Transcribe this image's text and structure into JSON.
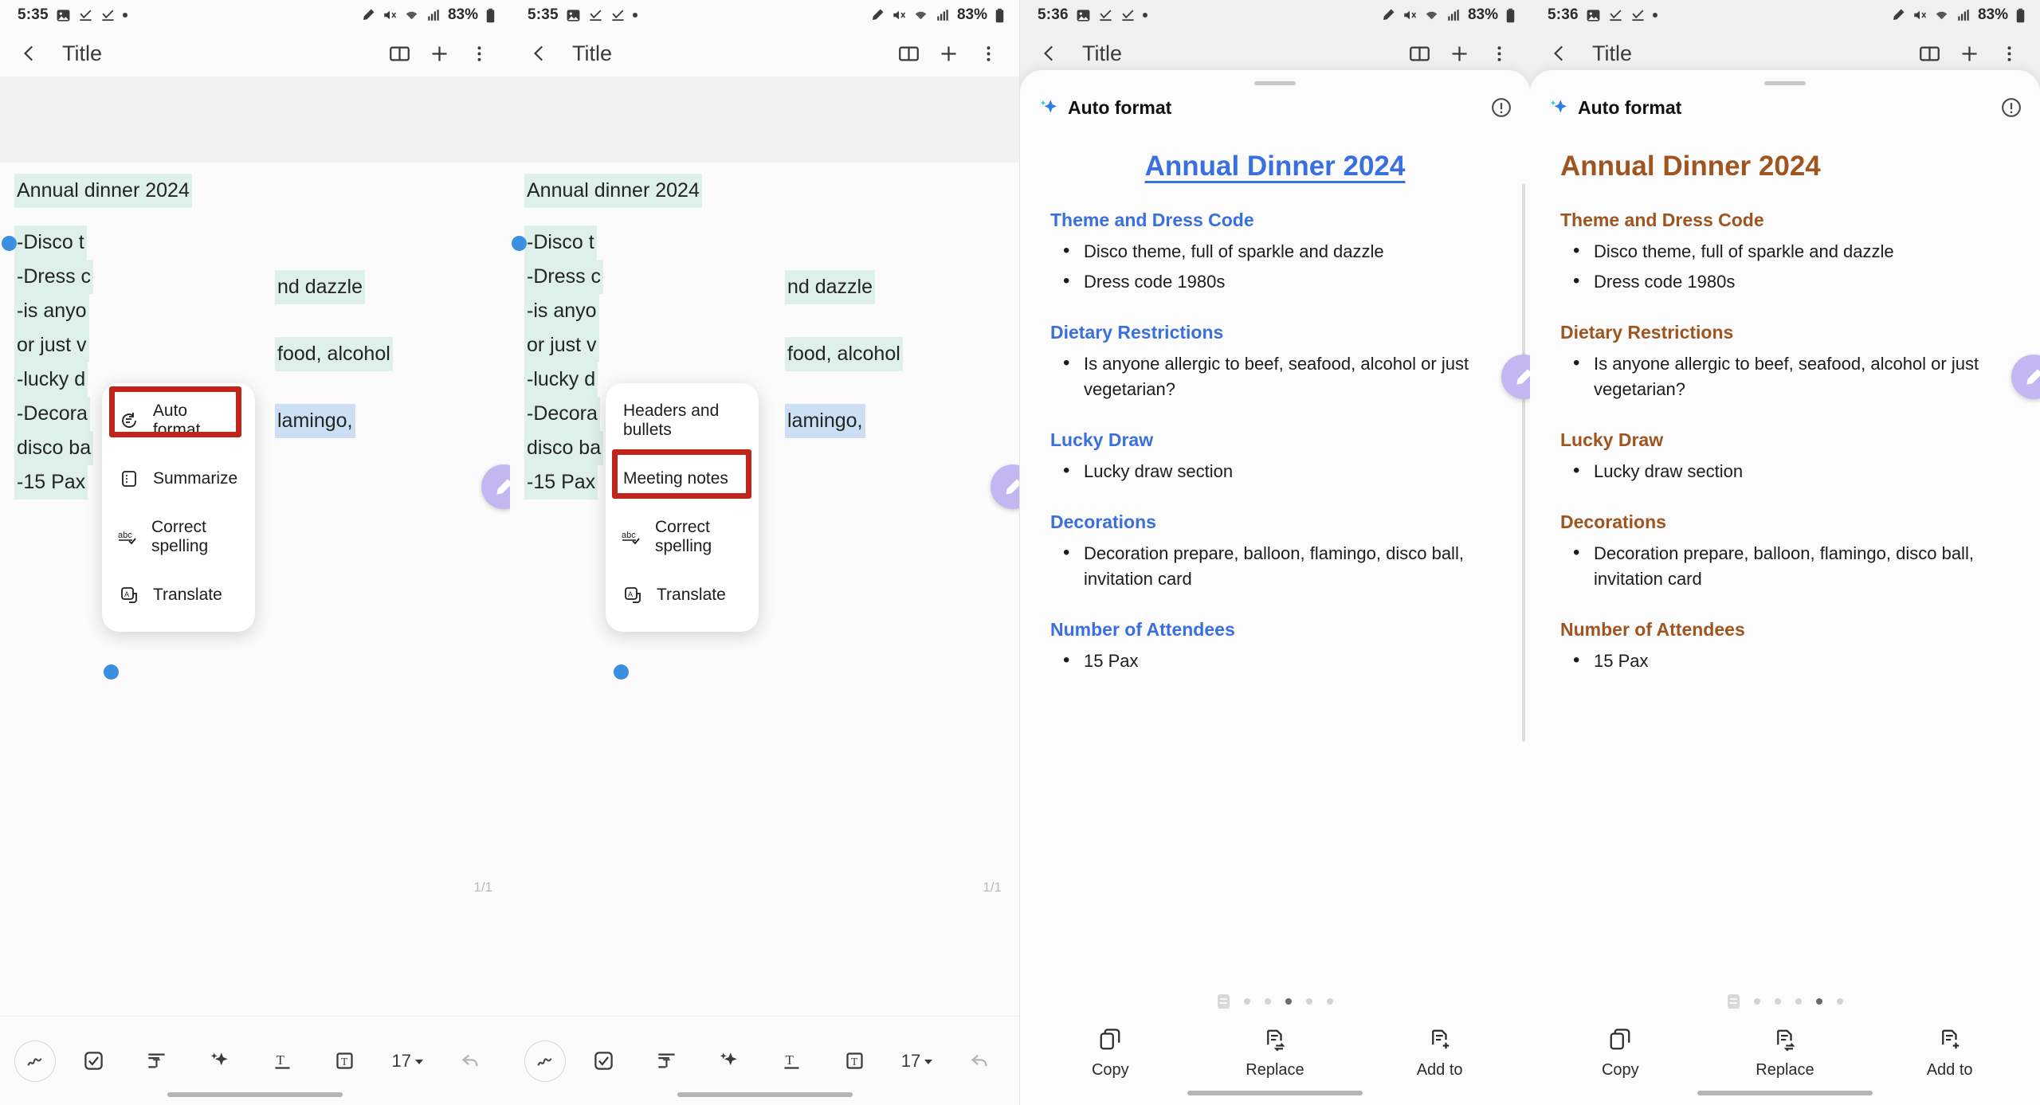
{
  "panels": [
    {
      "id": "panel-menu-autoformat",
      "statusbar": {
        "time": "5:35",
        "battery": "83%",
        "icons": [
          "image-icon",
          "check-underline-icon",
          "check-underline-icon",
          "dot-icon"
        ],
        "right_icons": [
          "spen-icon",
          "mute-icon",
          "wifi-icon",
          "signal-icon",
          "battery-icon"
        ]
      },
      "appbar": {
        "back": "back-icon",
        "title": "Title",
        "view": "book-icon",
        "add": "plus-icon",
        "more": "more-vertical-icon"
      },
      "note": {
        "title": "Annual dinner 2024",
        "lines": [
          "-Disco t",
          "-Dress c",
          "-is anyo",
          "or just v",
          "-lucky d",
          "-Decora",
          "disco ba",
          "-15 Pax"
        ],
        "right_fragments": [
          "nd dazzle",
          "food, alcohol",
          "lamingo,"
        ],
        "page_indicator": "1/1"
      },
      "menu": {
        "items": [
          {
            "label": "Auto format",
            "icon": "auto-format-icon",
            "highlighted": true
          },
          {
            "label": "Summarize",
            "icon": "summarize-icon",
            "highlighted": false
          },
          {
            "label": "Correct spelling",
            "icon": "abc-check-icon",
            "highlighted": false
          },
          {
            "label": "Translate",
            "icon": "translate-icon",
            "highlighted": false
          }
        ]
      },
      "toolbar": {
        "font_size": "17",
        "items": [
          "handwriting-icon",
          "checkbox-icon",
          "text-list-icon",
          "ai-sparkle-icon",
          "text-underline-icon",
          "text-box-icon",
          "font-size-dropdown",
          "undo-icon"
        ]
      }
    },
    {
      "id": "panel-menu-meetingnotes",
      "statusbar": {
        "time": "5:35",
        "battery": "83%"
      },
      "appbar": {
        "title": "Title"
      },
      "note": {
        "title": "Annual dinner 2024",
        "lines": [
          "-Disco t",
          "-Dress c",
          "-is anyo",
          "or just v",
          "-lucky d",
          "-Decora",
          "disco ba",
          "-15 Pax"
        ],
        "right_fragments": [
          "nd dazzle",
          "food, alcohol",
          "lamingo,"
        ],
        "page_indicator": "1/1"
      },
      "menu": {
        "items": [
          {
            "label": "Headers and bullets",
            "icon": "none",
            "highlighted": false
          },
          {
            "label": "Meeting notes",
            "icon": "none",
            "highlighted": true
          },
          {
            "label": "Correct spelling",
            "icon": "abc-check-icon",
            "highlighted": false
          },
          {
            "label": "Translate",
            "icon": "translate-icon",
            "highlighted": false
          }
        ]
      },
      "toolbar": {
        "font_size": "17"
      }
    },
    {
      "id": "panel-result-blue",
      "statusbar": {
        "time": "5:36",
        "battery": "83%"
      },
      "appbar": {
        "title": "Title"
      },
      "sheet": {
        "header_title": "Auto format",
        "header_icon": "ai-sparkle-icon",
        "info_icon": "info-circle-icon",
        "accent": "#3a6fe0",
        "doc_title": "Annual Dinner 2024",
        "sections": [
          {
            "heading": "Theme and Dress Code",
            "bullets": [
              "Disco theme, full of sparkle and dazzle",
              "Dress code 1980s"
            ]
          },
          {
            "heading": "Dietary Restrictions",
            "bullets": [
              "Is anyone allergic to beef, seafood, alcohol or just vegetarian?"
            ]
          },
          {
            "heading": "Lucky Draw",
            "bullets": [
              "Lucky draw section"
            ]
          },
          {
            "heading": "Decorations",
            "bullets": [
              "Decoration prepare, balloon, flamingo, disco ball, invitation card"
            ]
          },
          {
            "heading": "Number of Attendees",
            "bullets": [
              "15 Pax"
            ]
          }
        ],
        "pager": {
          "total": 5,
          "active": 3
        },
        "actions": [
          {
            "label": "Copy",
            "icon": "copy-icon"
          },
          {
            "label": "Replace",
            "icon": "replace-icon"
          },
          {
            "label": "Add to",
            "icon": "add-to-icon"
          }
        ]
      }
    },
    {
      "id": "panel-result-orange",
      "statusbar": {
        "time": "5:36",
        "battery": "83%"
      },
      "appbar": {
        "title": "Title"
      },
      "sheet": {
        "header_title": "Auto format",
        "header_icon": "ai-sparkle-icon",
        "info_icon": "info-circle-icon",
        "accent": "#9e5520",
        "doc_title": "Annual Dinner 2024",
        "sections": [
          {
            "heading": "Theme and Dress Code",
            "bullets": [
              "Disco theme, full of sparkle and dazzle",
              "Dress code 1980s"
            ]
          },
          {
            "heading": "Dietary Restrictions",
            "bullets": [
              "Is anyone allergic to beef, seafood, alcohol or just vegetarian?"
            ]
          },
          {
            "heading": "Lucky Draw",
            "bullets": [
              "Lucky draw section"
            ]
          },
          {
            "heading": "Decorations",
            "bullets": [
              "Decoration prepare, balloon, flamingo, disco ball, invitation card"
            ]
          },
          {
            "heading": "Number of Attendees",
            "bullets": [
              "15 Pax"
            ]
          }
        ],
        "pager": {
          "total": 5,
          "active": 5
        },
        "actions": [
          {
            "label": "Copy",
            "icon": "copy-icon"
          },
          {
            "label": "Replace",
            "icon": "replace-icon"
          },
          {
            "label": "Add to",
            "icon": "add-to-icon"
          }
        ]
      }
    }
  ]
}
